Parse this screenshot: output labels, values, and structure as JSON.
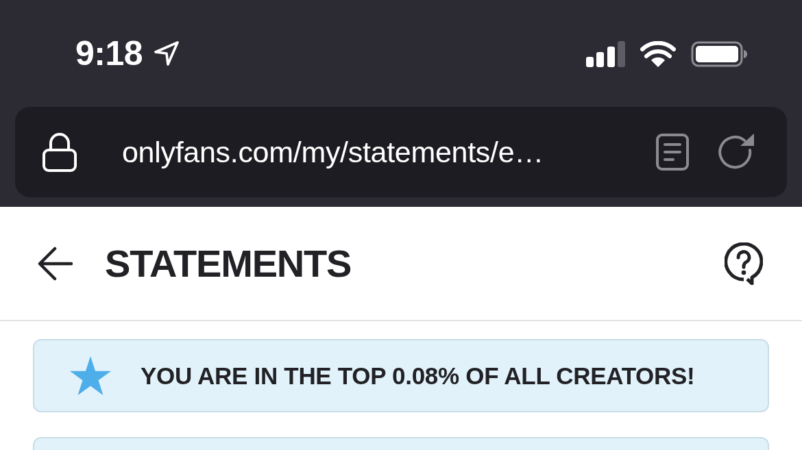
{
  "status_bar": {
    "time": "9:18"
  },
  "address_bar": {
    "url": "onlyfans.com/my/statements/e…"
  },
  "header": {
    "title": "STATEMENTS"
  },
  "banner": {
    "text": "YOU ARE IN THE TOP 0.08% OF ALL CREATORS!"
  }
}
